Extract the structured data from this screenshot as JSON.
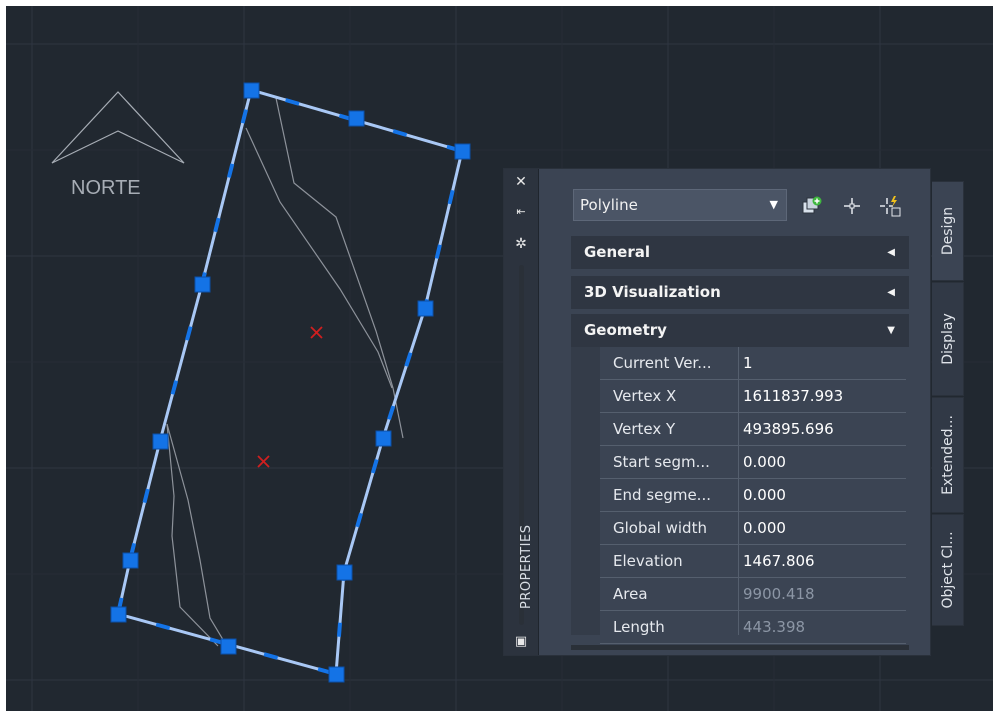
{
  "drawing": {
    "north_label": "NORTE"
  },
  "properties": {
    "title": "PROPERTIES",
    "object_type": "Polyline",
    "sections": {
      "general": "General",
      "visualization": "3D Visualization",
      "geometry": "Geometry"
    },
    "geometry_rows": [
      {
        "name": "Current Ver...",
        "value": "1"
      },
      {
        "name": "Vertex X",
        "value": "1611837.993"
      },
      {
        "name": "Vertex Y",
        "value": "493895.696"
      },
      {
        "name": "Start segm...",
        "value": "0.000"
      },
      {
        "name": "End segme...",
        "value": "0.000"
      },
      {
        "name": "Global width",
        "value": "0.000"
      },
      {
        "name": "Elevation",
        "value": "1467.806"
      },
      {
        "name": "Area",
        "value": "9900.418"
      },
      {
        "name": "Length",
        "value": "443.398"
      }
    ],
    "tabs": [
      "Design",
      "Display",
      "Extended...",
      "Object Cl..."
    ]
  },
  "colors": {
    "canvas_bg": "#212830",
    "selection_blue": "#1473e6",
    "boundary_line": "#a9c8f5",
    "marker_red": "#d11f1f"
  }
}
